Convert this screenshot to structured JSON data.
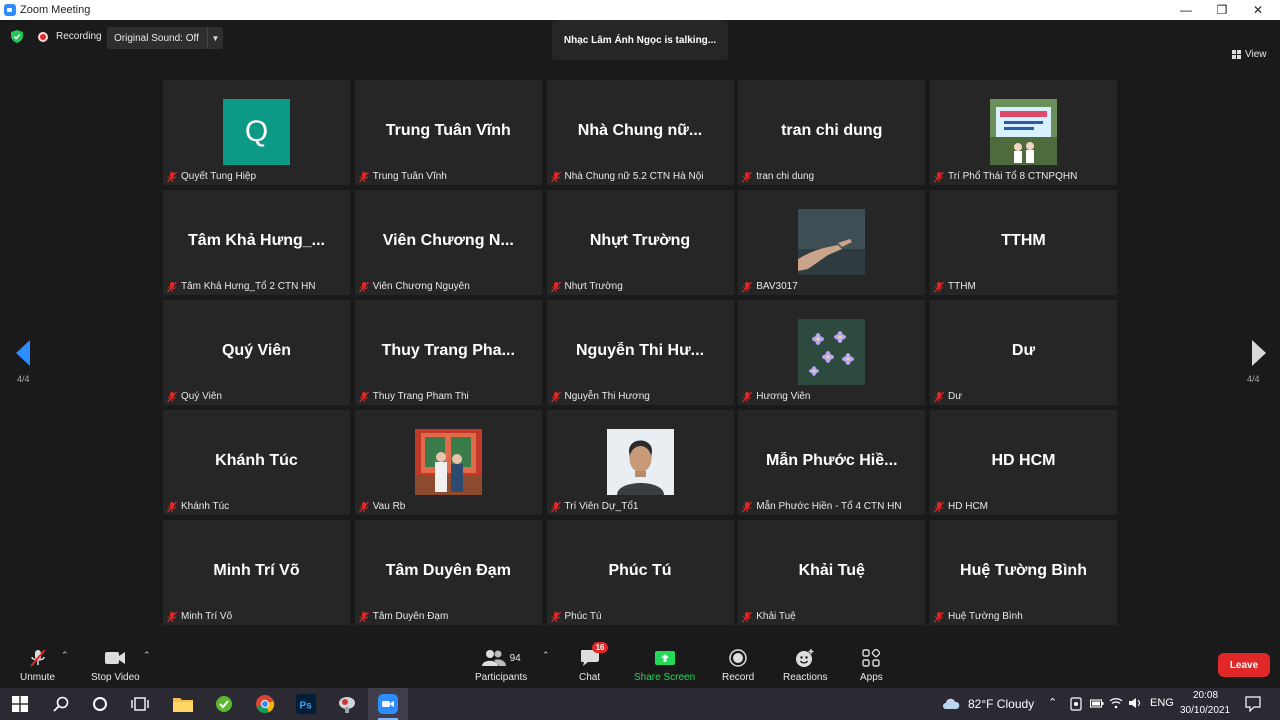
{
  "window": {
    "title": "Zoom Meeting"
  },
  "topbar": {
    "recording_label": "Recording",
    "original_sound_label": "Original Sound: Off",
    "talking_banner": "Nhạc Lâm Ánh Ngọc is talking...",
    "view_label": "View"
  },
  "nav": {
    "page_left": "4/4",
    "page_right": "4/4"
  },
  "tiles": [
    {
      "display": "",
      "name": "Quyết Tung Hiệp",
      "avatar": "letter",
      "letter": "Q"
    },
    {
      "display": "Trung Tuân Vĩnh",
      "name": "Trung Tuân Vĩnh"
    },
    {
      "display": "Nhà Chung nữ...",
      "name": "Nhà Chung nữ 5.2 CTN Hà Nội"
    },
    {
      "display": "tran chi dung",
      "name": "tran chi dung"
    },
    {
      "display": "",
      "name": "Trí Phổ Thái Tổ 8 CTNPQHN",
      "avatar": "photo-banner"
    },
    {
      "display": "Tâm Khả Hưng_...",
      "name": "Tâm Khả Hưng_Tổ 2 CTN HN"
    },
    {
      "display": "Viên Chương N...",
      "name": "Viên Chương Nguyên"
    },
    {
      "display": "Nhựt Trường",
      "name": "Nhựt Trường"
    },
    {
      "display": "",
      "name": "BAV3017",
      "avatar": "photo-hand"
    },
    {
      "display": "TTHM",
      "name": "TTHM"
    },
    {
      "display": "Quý Viên",
      "name": "Quý Viên"
    },
    {
      "display": "Thuy Trang Pha...",
      "name": "Thuy Trang Pham Thi"
    },
    {
      "display": "Nguyễn Thi Hư...",
      "name": "Nguyễn Thi Hương"
    },
    {
      "display": "",
      "name": "Hương Viên",
      "avatar": "photo-flowers"
    },
    {
      "display": "Dư",
      "name": "Dư"
    },
    {
      "display": "Khánh Túc",
      "name": "Khánh Túc"
    },
    {
      "display": "",
      "name": "Vau Rb",
      "avatar": "photo-people"
    },
    {
      "display": "",
      "name": "Trí Viên Dự_Tổ1",
      "avatar": "photo-man"
    },
    {
      "display": "Mẫn Phước Hiề...",
      "name": "Mẫn Phước Hiền - Tổ 4 CTN HN"
    },
    {
      "display": "HD HCM",
      "name": "HD HCM"
    },
    {
      "display": "Minh Trí Võ",
      "name": "Minh Trí Võ"
    },
    {
      "display": "Tâm Duyên Đạm",
      "name": "Tâm Duyên Đạm"
    },
    {
      "display": "Phúc Tú",
      "name": "Phúc Tú"
    },
    {
      "display": "Khải Tuệ",
      "name": "Khải Tuệ"
    },
    {
      "display": "Huệ Tường Bình",
      "name": "Huệ Tường Bình"
    }
  ],
  "toolbar": {
    "unmute": "Unmute",
    "stop_video": "Stop Video",
    "participants": "Participants",
    "participants_count": "94",
    "chat": "Chat",
    "chat_badge": "16",
    "share_screen": "Share Screen",
    "record": "Record",
    "reactions": "Reactions",
    "apps": "Apps",
    "leave": "Leave"
  },
  "taskbar": {
    "weather": "82°F  Cloudy",
    "language": "ENG",
    "time": "20:08",
    "date": "30/10/2021"
  },
  "colors": {
    "accent_blue": "#2d8cff",
    "share_green": "#23d959",
    "leave_red": "#e02828",
    "avatar_teal": "#0c9985"
  }
}
